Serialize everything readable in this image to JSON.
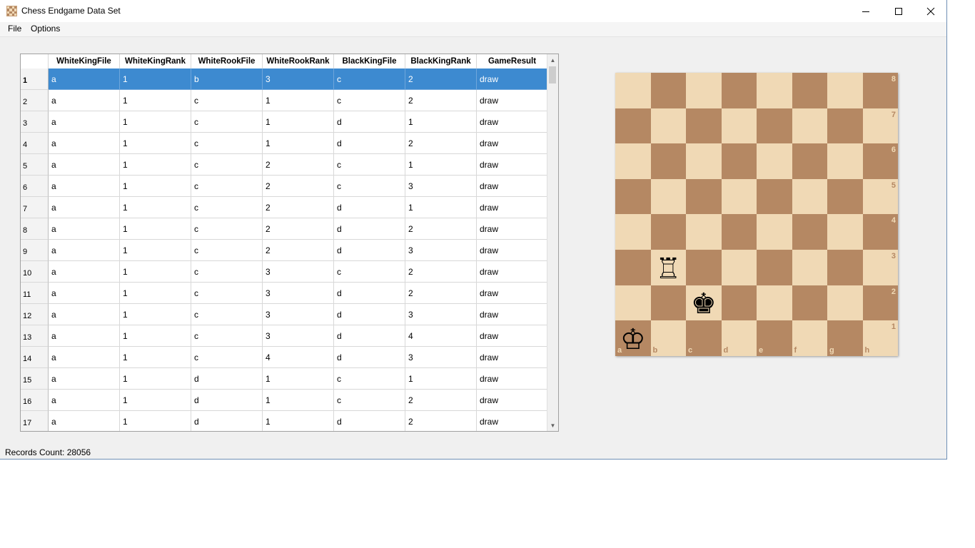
{
  "window": {
    "title": "Chess Endgame Data Set"
  },
  "menu": {
    "file": "File",
    "options": "Options"
  },
  "table": {
    "columns": [
      "WhiteKingFile",
      "WhiteKingRank",
      "WhiteRookFile",
      "WhiteRookRank",
      "BlackKingFile",
      "BlackKingRank",
      "GameResult"
    ],
    "rows": [
      {
        "n": "1",
        "c": [
          "a",
          "1",
          "b",
          "3",
          "c",
          "2",
          "draw"
        ]
      },
      {
        "n": "2",
        "c": [
          "a",
          "1",
          "c",
          "1",
          "c",
          "2",
          "draw"
        ]
      },
      {
        "n": "3",
        "c": [
          "a",
          "1",
          "c",
          "1",
          "d",
          "1",
          "draw"
        ]
      },
      {
        "n": "4",
        "c": [
          "a",
          "1",
          "c",
          "1",
          "d",
          "2",
          "draw"
        ]
      },
      {
        "n": "5",
        "c": [
          "a",
          "1",
          "c",
          "2",
          "c",
          "1",
          "draw"
        ]
      },
      {
        "n": "6",
        "c": [
          "a",
          "1",
          "c",
          "2",
          "c",
          "3",
          "draw"
        ]
      },
      {
        "n": "7",
        "c": [
          "a",
          "1",
          "c",
          "2",
          "d",
          "1",
          "draw"
        ]
      },
      {
        "n": "8",
        "c": [
          "a",
          "1",
          "c",
          "2",
          "d",
          "2",
          "draw"
        ]
      },
      {
        "n": "9",
        "c": [
          "a",
          "1",
          "c",
          "2",
          "d",
          "3",
          "draw"
        ]
      },
      {
        "n": "10",
        "c": [
          "a",
          "1",
          "c",
          "3",
          "c",
          "2",
          "draw"
        ]
      },
      {
        "n": "11",
        "c": [
          "a",
          "1",
          "c",
          "3",
          "d",
          "2",
          "draw"
        ]
      },
      {
        "n": "12",
        "c": [
          "a",
          "1",
          "c",
          "3",
          "d",
          "3",
          "draw"
        ]
      },
      {
        "n": "13",
        "c": [
          "a",
          "1",
          "c",
          "3",
          "d",
          "4",
          "draw"
        ]
      },
      {
        "n": "14",
        "c": [
          "a",
          "1",
          "c",
          "4",
          "d",
          "3",
          "draw"
        ]
      },
      {
        "n": "15",
        "c": [
          "a",
          "1",
          "d",
          "1",
          "c",
          "1",
          "draw"
        ]
      },
      {
        "n": "16",
        "c": [
          "a",
          "1",
          "d",
          "1",
          "c",
          "2",
          "draw"
        ]
      },
      {
        "n": "17",
        "c": [
          "a",
          "1",
          "d",
          "1",
          "d",
          "2",
          "draw"
        ]
      }
    ],
    "selected_row": 1
  },
  "status": {
    "records_count": "Records Count: 28056"
  },
  "board": {
    "files": [
      "a",
      "b",
      "c",
      "d",
      "e",
      "f",
      "g",
      "h"
    ],
    "ranks": [
      "8",
      "7",
      "6",
      "5",
      "4",
      "3",
      "2",
      "1"
    ],
    "pieces": [
      {
        "square": "a1",
        "piece": "white-king",
        "glyph": "♔"
      },
      {
        "square": "b3",
        "piece": "white-rook",
        "glyph": "♖"
      },
      {
        "square": "c2",
        "piece": "black-king",
        "glyph": "♚"
      }
    ],
    "colors": {
      "light": "#f0d9b5",
      "dark": "#b58863"
    }
  },
  "colors": {
    "selection": "#3d8ad0"
  }
}
